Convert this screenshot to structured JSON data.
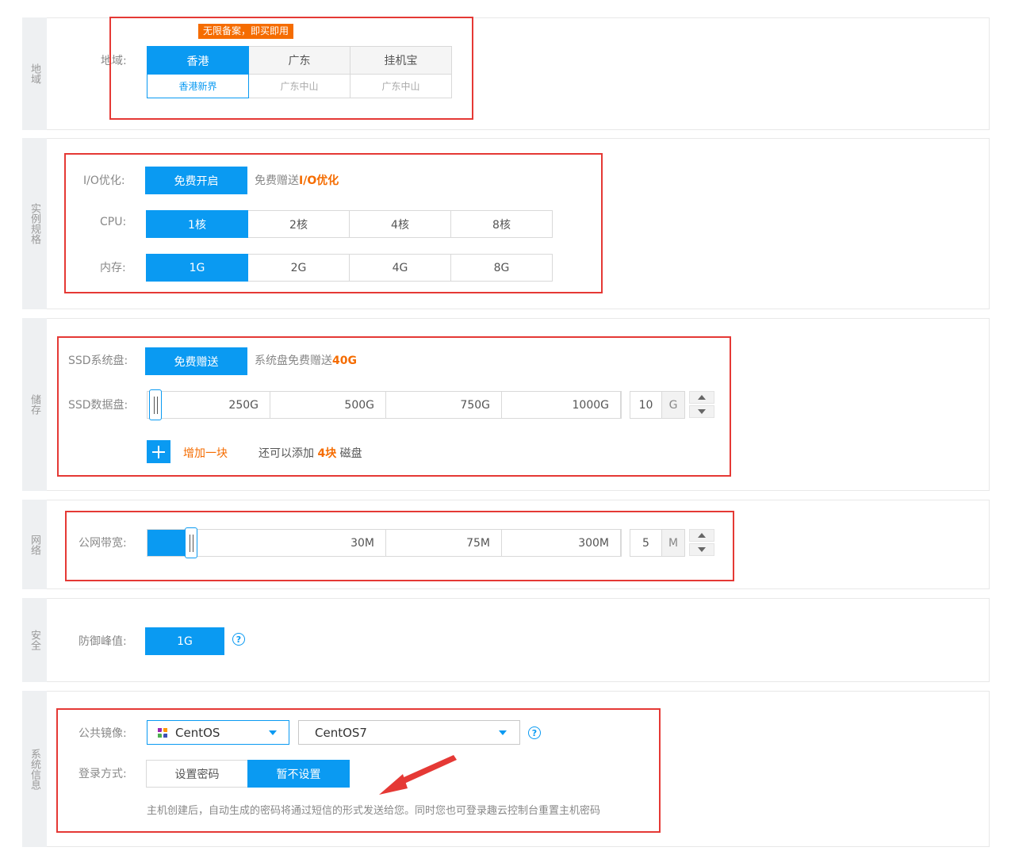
{
  "region": {
    "side": "地域",
    "label": "地域:",
    "promo": "无限备案，即买即用",
    "options": [
      {
        "name": "香港",
        "sub": "香港新界"
      },
      {
        "name": "广东",
        "sub": "广东中山"
      },
      {
        "name": "挂机宝",
        "sub": "广东中山"
      }
    ],
    "selected": "香港"
  },
  "spec": {
    "side": "实例规格",
    "io": {
      "label": "I/O优化:",
      "button": "免费开启",
      "hint_prefix": "免费赠送",
      "hint_highlight": "I/O优化"
    },
    "cpu": {
      "label": "CPU:",
      "options": [
        "1核",
        "2核",
        "4核",
        "8核"
      ],
      "selected": "1核"
    },
    "memory": {
      "label": "内存:",
      "options": [
        "1G",
        "2G",
        "4G",
        "8G"
      ],
      "selected": "1G"
    }
  },
  "storage": {
    "side": "储存",
    "system_disk": {
      "label": "SSD系统盘:",
      "button": "免费赠送",
      "hint_prefix": "系统盘免费赠送",
      "hint_highlight": "40G"
    },
    "data_disk": {
      "label": "SSD数据盘:",
      "marks": [
        "250G",
        "500G",
        "750G",
        "1000G"
      ],
      "value": "10",
      "unit": "G"
    },
    "add": {
      "label": "增加一块",
      "note_prefix": "还可以添加",
      "note_highlight": "4块",
      "note_suffix": "磁盘"
    }
  },
  "network": {
    "side": "网络",
    "bandwidth": {
      "label": "公网带宽:",
      "marks": [
        "30M",
        "75M",
        "300M"
      ],
      "value": "5",
      "unit": "M"
    }
  },
  "security": {
    "side": "安全",
    "label": "防御峰值:",
    "value": "1G"
  },
  "system": {
    "side": "系统信息",
    "image_label": "公共镜像:",
    "os": "CentOS",
    "os_version": "CentOS7",
    "login_label": "登录方式:",
    "login_options": [
      "设置密码",
      "暂不设置"
    ],
    "login_selected": "暂不设置",
    "note": "主机创建后，自动生成的密码将通过短信的形式发送给您。同时您也可登录趣云控制台重置主机密码"
  },
  "colors": {
    "accent": "#0a9af2",
    "highlight": "#f56c00",
    "annotation": "#e53935"
  }
}
